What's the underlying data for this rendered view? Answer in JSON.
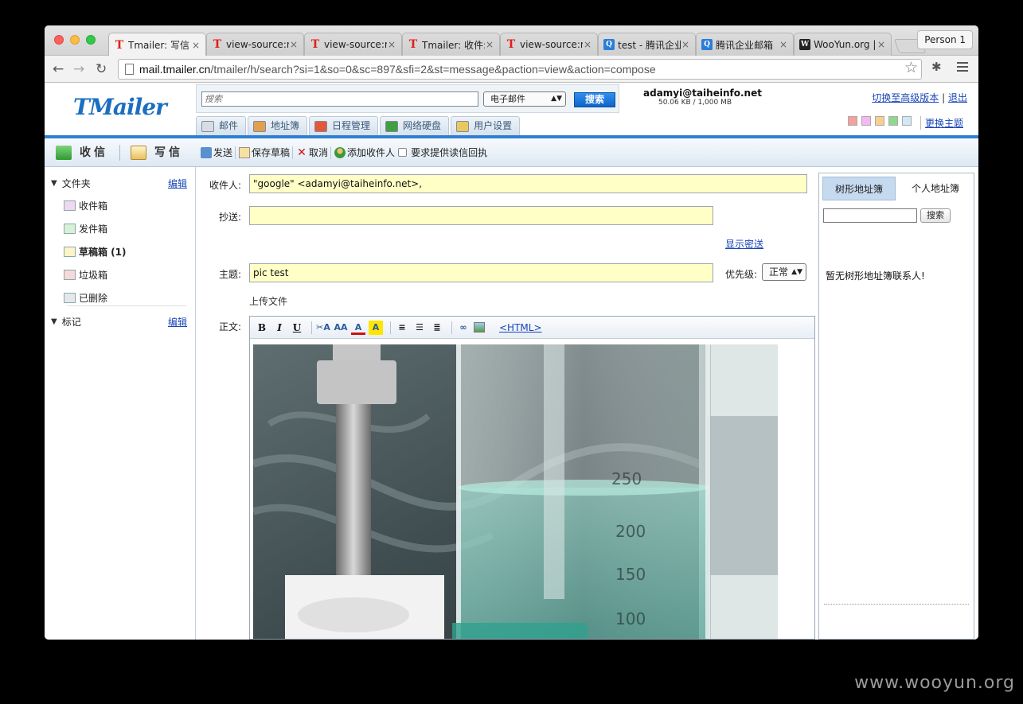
{
  "browser": {
    "tabs": [
      {
        "title": "Tmailer: 写信",
        "favicon": "T",
        "active": true
      },
      {
        "title": "view-source:m",
        "favicon": "T",
        "active": false
      },
      {
        "title": "view-source:m",
        "favicon": "T",
        "active": false
      },
      {
        "title": "Tmailer: 收件:",
        "favicon": "T",
        "active": false
      },
      {
        "title": "view-source:m",
        "favicon": "T",
        "active": false
      },
      {
        "title": "test - 腾讯企业",
        "favicon": "Q",
        "active": false
      },
      {
        "title": "腾讯企业邮箱",
        "favicon": "Q",
        "active": false
      },
      {
        "title": "WooYun.org |",
        "favicon": "W",
        "active": false
      }
    ],
    "tab_close": "×",
    "profile": "Person 1",
    "url_host": "mail.tmailer.cn",
    "url_path": "/tmailer/h/search?si=1&so=0&sc=897&sfi=2&st=message&paction=view&action=compose"
  },
  "header": {
    "logo": "TMailer",
    "search_placeholder": "搜索",
    "search_scope": "电子邮件",
    "search_button": "搜索",
    "account_email": "adamyi@taiheinfo.net",
    "quota": "50.06 KB / 1,000 MB",
    "switch_version": "切换至高级版本",
    "logout": "退出",
    "change_theme": "更换主题",
    "theme_colors": [
      "#f4a0a0",
      "#f6b8f0",
      "#f8cf90",
      "#8fd88f",
      "#d0e8f8"
    ],
    "nav_tabs": [
      {
        "label": "邮件",
        "icon": "mail-icon"
      },
      {
        "label": "地址簿",
        "icon": "contacts-icon"
      },
      {
        "label": "日程管理",
        "icon": "calendar-icon"
      },
      {
        "label": "网络硬盘",
        "icon": "disk-icon"
      },
      {
        "label": "用户设置",
        "icon": "settings-icon"
      }
    ]
  },
  "actionbar": {
    "receive": "收信",
    "compose": "写信",
    "send": "发送",
    "save_draft": "保存草稿",
    "cancel": "取消",
    "add_recipient": "添加收件人",
    "read_receipt": "要求提供读信回执"
  },
  "sidebar": {
    "folders_title": "文件夹",
    "edit": "编辑",
    "folders": [
      {
        "label": "收件箱",
        "bold": false
      },
      {
        "label": "发件箱",
        "bold": false
      },
      {
        "label": "草稿箱 (1)",
        "bold": true
      },
      {
        "label": "垃圾箱",
        "bold": false
      },
      {
        "label": "已删除",
        "bold": false
      }
    ],
    "tags_title": "标记",
    "tags_edit": "编辑"
  },
  "compose": {
    "to_label": "收件人:",
    "to_value": "\"google\" <adamyi@taiheinfo.net>,",
    "cc_label": "抄送:",
    "cc_value": "",
    "show_bcc": "显示密送",
    "subject_label": "主题:",
    "subject_value": "pic test",
    "priority_label": "优先级:",
    "priority_value": "正常",
    "upload": "上传文件",
    "body_label": "正文:",
    "html_toggle": "<HTML>",
    "bold": "B",
    "italic": "I",
    "underline": "U"
  },
  "addressbook": {
    "tab_tree": "树形地址簿",
    "tab_personal": "个人地址簿",
    "search_button": "搜索",
    "empty_text": "暂无树形地址簿联系人!"
  },
  "watermark": "www.wooyun.org"
}
